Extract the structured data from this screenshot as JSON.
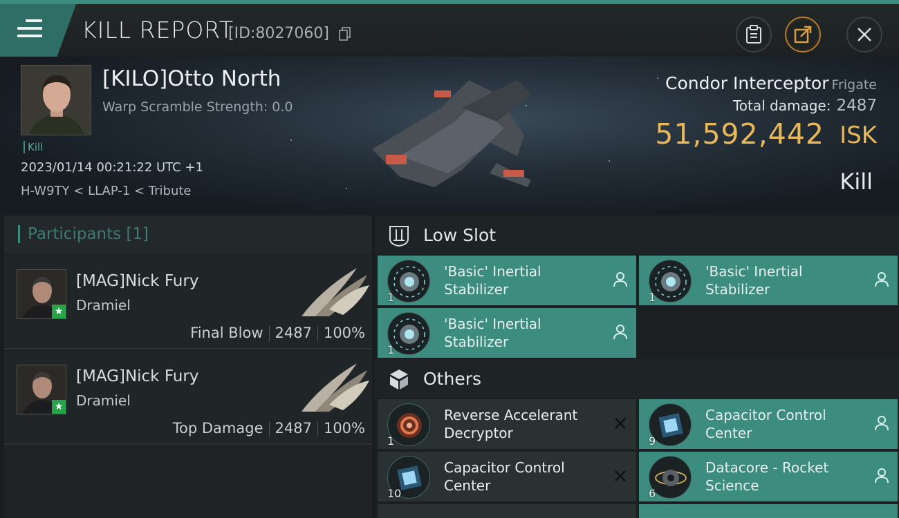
{
  "header": {
    "title": "KILL REPORT",
    "report_id": "[ID:8027060]"
  },
  "victim": {
    "name": "[KILO]Otto North",
    "warp_scramble": "Warp Scramble Strength: 0.0",
    "tag": "Kill",
    "datetime": "2023/01/14 00:21:22 UTC +1",
    "location": "H-W9TY < LLAP-1 < Tribute",
    "ship_name": "Condor Interceptor",
    "ship_class": "Frigate",
    "total_damage_label": "Total damage:",
    "total_damage": "2487",
    "isk_value": "51,592,442",
    "isk_unit": "ISK",
    "result": "Kill"
  },
  "participants": {
    "header": "Participants [1]",
    "rows": [
      {
        "name": "[MAG]Nick Fury",
        "ship": "Dramiel",
        "role": "Final Blow",
        "damage": "2487",
        "percent": "100%"
      },
      {
        "name": "[MAG]Nick Fury",
        "ship": "Dramiel",
        "role": "Top Damage",
        "damage": "2487",
        "percent": "100%"
      }
    ]
  },
  "fitting": {
    "low_slot_label": "Low Slot",
    "others_label": "Others",
    "low_slot_items": [
      {
        "name": "'Basic' Inertial Stabilizer",
        "qty": "1",
        "status": "dropped"
      },
      {
        "name": "'Basic' Inertial Stabilizer",
        "qty": "1",
        "status": "dropped"
      },
      {
        "name": "'Basic' Inertial Stabilizer",
        "qty": "1",
        "status": "dropped"
      }
    ],
    "other_items": [
      {
        "name": "Reverse Accelerant Decryptor",
        "qty": "1",
        "status": "destroyed"
      },
      {
        "name": "Capacitor Control Center",
        "qty": "9",
        "status": "dropped"
      },
      {
        "name": "Capacitor Control Center",
        "qty": "10",
        "status": "destroyed"
      },
      {
        "name": "Datacore - Rocket Science",
        "qty": "6",
        "status": "dropped"
      }
    ]
  },
  "colors": {
    "accent": "#3d8c80",
    "isk": "#e8b85a",
    "dropped_bg": "#3c8c80",
    "destroyed_bg": "#2a3133"
  },
  "icons": {
    "menu": "hamburger-icon",
    "copy": "copy-icon",
    "clipboard": "clipboard-icon",
    "share": "share-icon",
    "close": "close-icon",
    "low_slot": "low-slot-icon",
    "others": "cube-icon",
    "dropped": "person-icon",
    "destroyed": "x-icon"
  }
}
